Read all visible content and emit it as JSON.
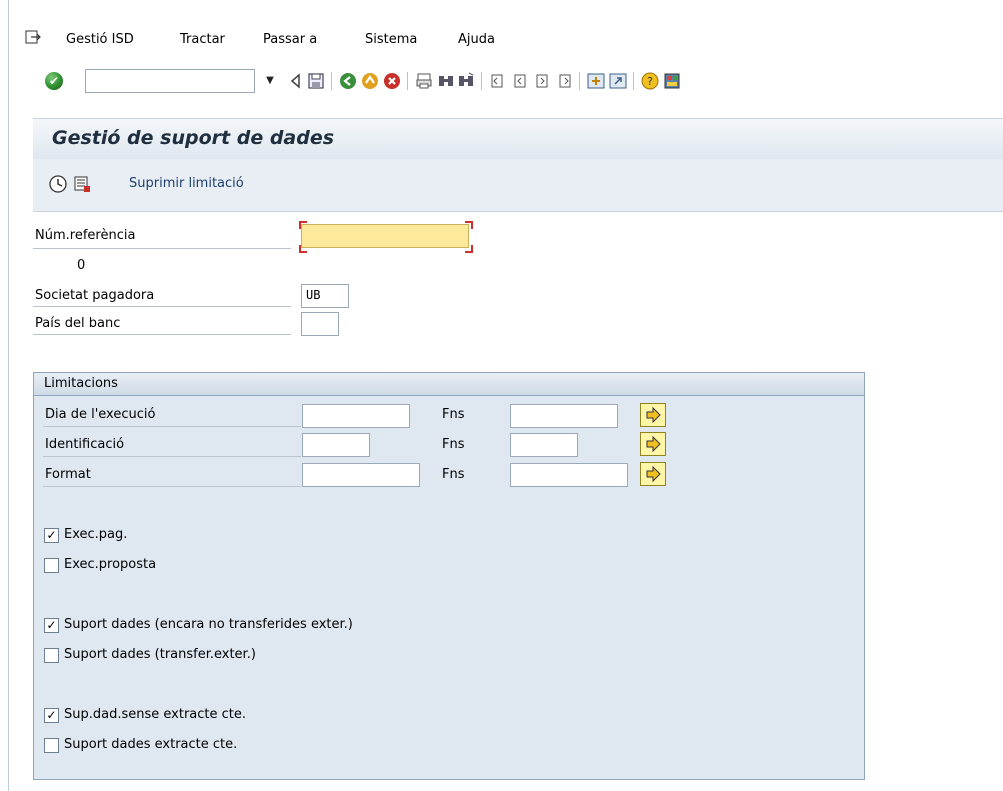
{
  "menubar": {
    "items": [
      "Gestió ISD",
      "Tractar",
      "Passar a",
      "Sistema",
      "Ajuda"
    ]
  },
  "toolbar": {
    "command_value": "",
    "icons": [
      "enter-icon",
      "back-icon",
      "save-icon",
      "green-back-icon",
      "exit-icon",
      "cancel-icon",
      "print-icon",
      "find-icon",
      "find-next-icon",
      "first-page-icon",
      "previous-page-icon",
      "next-page-icon",
      "last-page-icon",
      "create-session-icon",
      "shortcut-icon",
      "help-icon",
      "layout-icon"
    ]
  },
  "page": {
    "title": "Gestió de suport de dades",
    "actions": {
      "remove_limit": "Suprimir limitació"
    }
  },
  "fields": {
    "ref_label": "Núm.referència",
    "ref_value": "",
    "ref_count": "0",
    "company_label": "Societat pagadora",
    "company_value": "UB",
    "country_label": "País del banc",
    "country_value": ""
  },
  "limits": {
    "title": "Limitacions",
    "rows": [
      {
        "label": "Dia de l'execució",
        "to_label": "Fns",
        "from_value": "",
        "to_value": ""
      },
      {
        "label": "Identificació",
        "to_label": "Fns",
        "from_value": "",
        "to_value": ""
      },
      {
        "label": "Format",
        "to_label": "Fns",
        "from_value": "",
        "to_value": ""
      }
    ],
    "checkboxes": [
      {
        "label": "Exec.pag.",
        "checked": true
      },
      {
        "label": "Exec.proposta",
        "checked": false
      },
      {
        "label": "Suport dades (encara no transferides exter.)",
        "checked": true
      },
      {
        "label": "Suport dades (transfer.exter.)",
        "checked": false
      },
      {
        "label": "Sup.dad.sense extracte cte.",
        "checked": true
      },
      {
        "label": "Suport dades extracte cte.",
        "checked": false
      }
    ]
  }
}
